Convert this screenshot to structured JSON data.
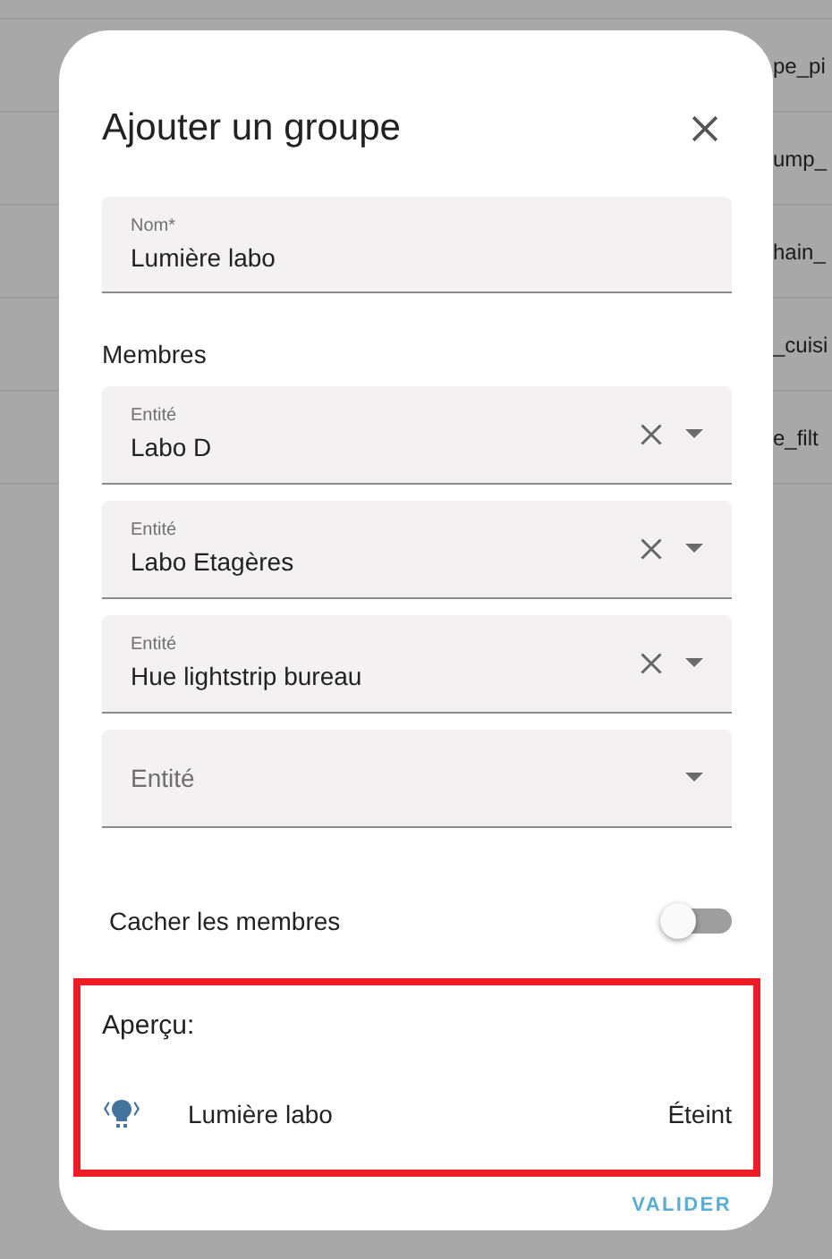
{
  "background_rows": [
    {
      "text": "pe_pi"
    },
    {
      "text": "ump_"
    },
    {
      "text": "hain_"
    },
    {
      "text": "_cuisi"
    },
    {
      "text": "e_filt"
    }
  ],
  "dialog": {
    "title": "Ajouter un groupe",
    "name_field": {
      "label": "Nom*",
      "value": "Lumière labo"
    },
    "members_heading": "Membres",
    "members": [
      {
        "kind": "filled",
        "label": "Entité",
        "value": "Labo D"
      },
      {
        "kind": "filled",
        "label": "Entité",
        "value": "Labo Etagères"
      },
      {
        "kind": "filled",
        "label": "Entité",
        "value": "Hue lightstrip bureau"
      },
      {
        "kind": "empty",
        "placeholder": "Entité"
      }
    ],
    "toggle": {
      "label": "Cacher les membres",
      "on": false
    },
    "preview": {
      "heading": "Aperçu:",
      "highlighted": true,
      "entity": {
        "name": "Lumière labo",
        "state": "Éteint"
      }
    },
    "buttons": [
      "VALIDER"
    ]
  }
}
